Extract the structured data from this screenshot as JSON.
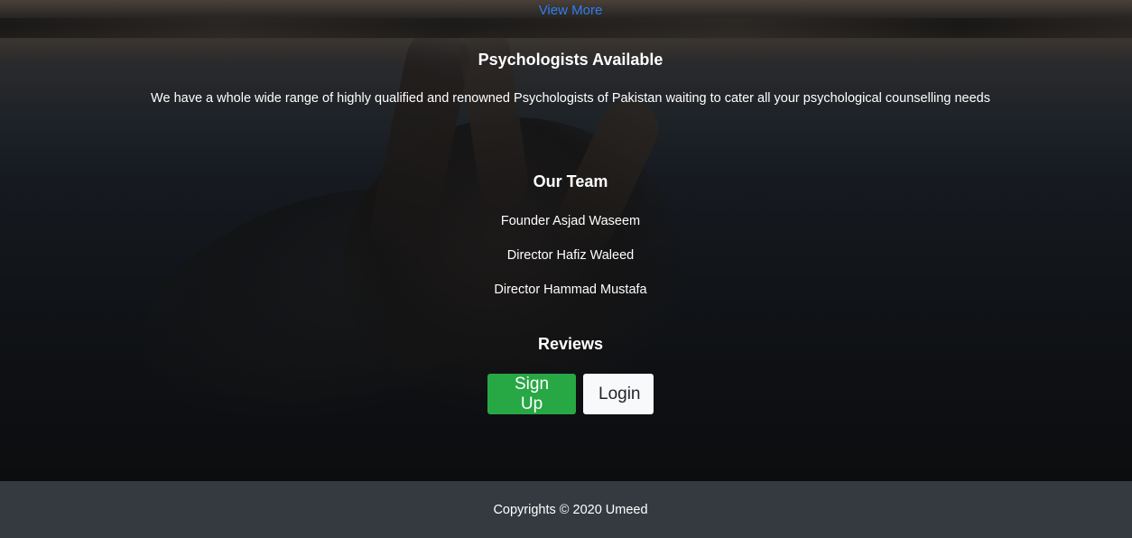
{
  "links": {
    "view_more": "View More"
  },
  "psychologists": {
    "title": "Psychologists Available",
    "description": "We have a whole wide range of highly qualified and renowned Psychologists of Pakistan waiting to cater all your psychological counselling needs"
  },
  "team": {
    "title": "Our Team",
    "members": [
      "Founder Asjad Waseem",
      "Director Hafiz Waleed",
      "Director Hammad Mustafa"
    ]
  },
  "reviews": {
    "title": "Reviews"
  },
  "buttons": {
    "signup_label": "Sign Up",
    "login_label": "Login"
  },
  "footer": {
    "copyright": "Copyrights © 2020 Umeed"
  },
  "colors": {
    "link": "#2f7ef0",
    "signup_bg": "#28a745",
    "login_bg": "#f8f9fa",
    "footer_bg": "#343a40"
  }
}
